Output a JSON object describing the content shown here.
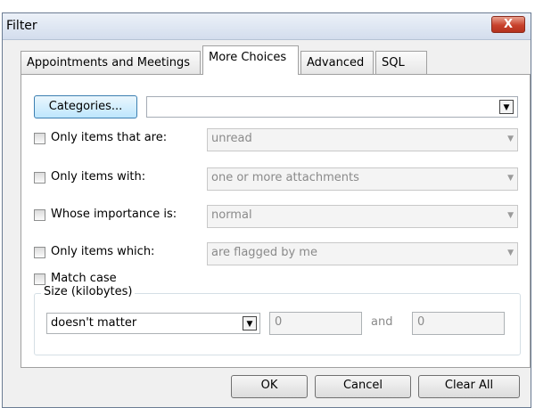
{
  "window": {
    "title": "Filter",
    "close_glyph": "X"
  },
  "tabs": [
    {
      "label": "Appointments and Meetings",
      "selected": false
    },
    {
      "label": "More Choices",
      "selected": true
    },
    {
      "label": "Advanced",
      "selected": false
    },
    {
      "label": "SQL",
      "selected": false
    }
  ],
  "categories": {
    "button_label": "Categories...",
    "value": ""
  },
  "criteria": [
    {
      "label": "Only items that are:",
      "checked": false,
      "value": "unread"
    },
    {
      "label": "Only items with:",
      "checked": false,
      "value": "one or more attachments"
    },
    {
      "label": "Whose importance is:",
      "checked": false,
      "value": "normal"
    },
    {
      "label": "Only items which:",
      "checked": false,
      "value": "are flagged by me"
    }
  ],
  "match_case": {
    "label": "Match case",
    "checked": false
  },
  "size": {
    "legend": "Size (kilobytes)",
    "condition": "doesn't matter",
    "from": "0",
    "and_label": "and",
    "to": "0"
  },
  "buttons": {
    "ok": "OK",
    "cancel": "Cancel",
    "clear_all": "Clear All"
  }
}
